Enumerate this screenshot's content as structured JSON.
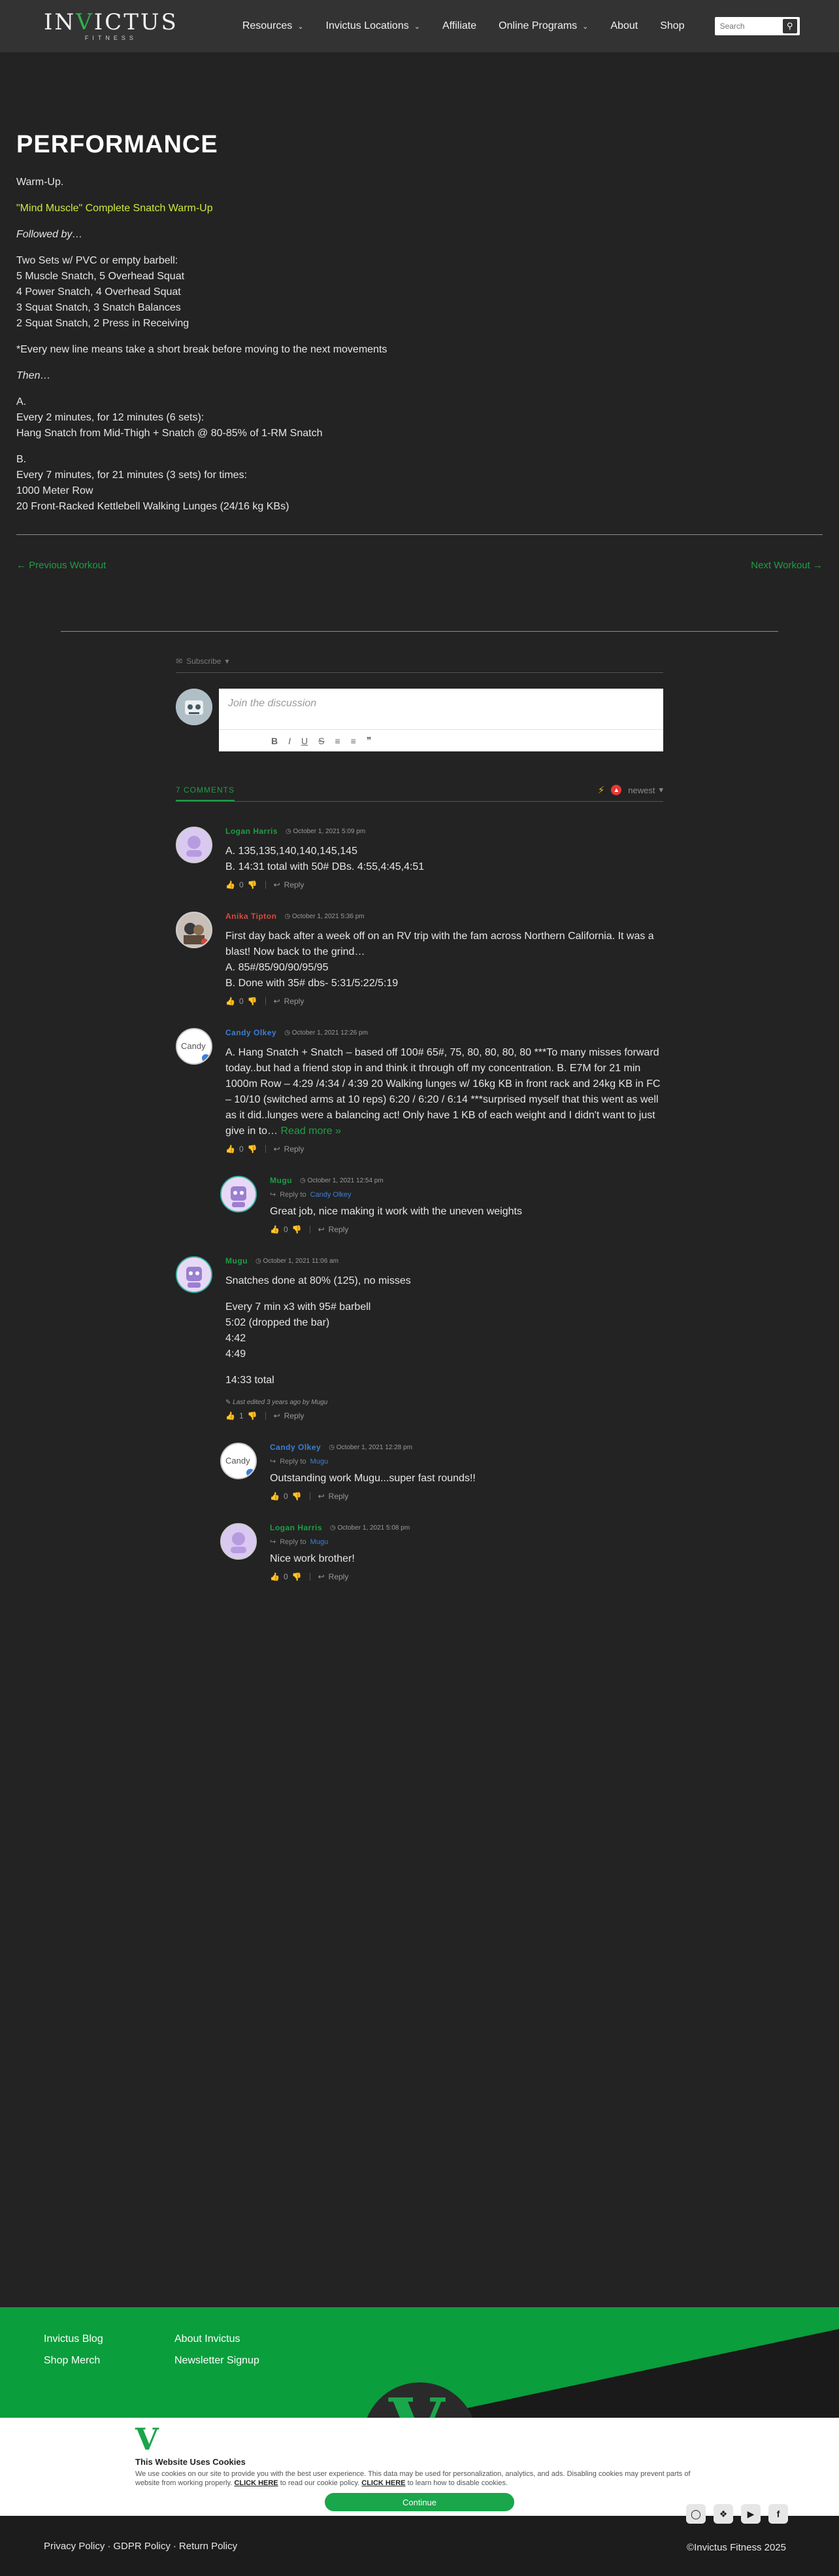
{
  "header": {
    "logo_word_a": "IN",
    "logo_word_v": "V",
    "logo_word_b": "ICTUS",
    "logo_sub": "FITNESS",
    "nav": [
      {
        "label": "Resources",
        "dropdown": true
      },
      {
        "label": "Invictus Locations",
        "dropdown": true
      },
      {
        "label": "Affiliate",
        "dropdown": false
      },
      {
        "label": "Online Programs",
        "dropdown": true
      },
      {
        "label": "About",
        "dropdown": false
      },
      {
        "label": "Shop",
        "dropdown": false
      }
    ],
    "search_placeholder": "Search"
  },
  "workout": {
    "title": "PERFORMANCE",
    "warmup": "Warm-Up.",
    "warmup_link": "\"Mind Muscle\" Complete Snatch Warm-Up",
    "followed_by": "Followed by…",
    "lines_sets": [
      "Two Sets w/ PVC or empty barbell:",
      "5 Muscle Snatch, 5 Overhead Squat",
      "4 Power Snatch, 4 Overhead Squat",
      "3 Squat Snatch, 3 Snatch Balances",
      "2 Squat Snatch, 2 Press in Receiving"
    ],
    "note": "*Every new line means take a short break before moving to the next movements",
    "then": "Then…",
    "part_a": [
      "A.",
      "Every 2 minutes, for 12 minutes (6 sets):",
      "Hang Snatch from Mid-Thigh + Snatch @ 80-85% of 1-RM Snatch"
    ],
    "part_b": [
      "B.",
      "Every 7 minutes, for 21 minutes (3 sets) for times:",
      "1000 Meter Row",
      "20 Front-Racked Kettlebell Walking Lunges (24/16 kg KBs)"
    ],
    "prev": "← Previous Workout",
    "next": "Next Workout →"
  },
  "comments_ui": {
    "subscribe": "Subscribe",
    "compose_placeholder": "Join the discussion",
    "toolbar": [
      "B",
      "I",
      "U",
      "S",
      "≡",
      "≡",
      "❞"
    ],
    "count": "7 COMMENTS",
    "sort": "newest"
  },
  "comments": [
    {
      "author": "Logan Harris",
      "color": "green",
      "date": "October 1, 2021 5:09 pm",
      "lines": [
        "A. 135,135,140,140,145,145",
        "B. 14:31 total with 50# DBs. 4:55,4:45,4:51"
      ],
      "likes": "0",
      "reply": "Reply"
    },
    {
      "author": "Anika Tipton",
      "color": "red",
      "date": "October 1, 2021 5:36 pm",
      "lines": [
        "First day back after a week off on an RV trip with the fam across Northern California. It was a blast! Now back to the grind…",
        "A. 85#/85/90/90/95/95",
        "B. Done with 35# dbs- 5:31/5:22/5:19"
      ],
      "likes": "0",
      "reply": "Reply"
    },
    {
      "author": "Candy Olkey",
      "color": "blue",
      "date": "October 1, 2021 12:26 pm",
      "lines": [
        "A. Hang Snatch + Snatch – based off 100# 65#, 75, 80, 80, 80, 80 ***To many misses forward today..but had a friend stop in and think it through off my concentration. B. E7M for 21 min 1000m Row – 4:29 /4:34 / 4:39 20 Walking lunges w/ 16kg KB in front rack and 24kg KB in FC – 10/10 (switched arms at 10 reps) 6:20 / 6:20 / 6:14 ***surprised myself that this went as well as it did..lunges were a balancing act! Only have 1 KB of each weight and I didn't want to just give in to…"
      ],
      "read_more": "Read more »",
      "likes": "0",
      "reply": "Reply"
    },
    {
      "author": "Mugu",
      "color": "green",
      "date": "October 1, 2021 12:54 pm",
      "reply_to": "Candy Olkey",
      "lines": [
        "Great job, nice making it work with the uneven weights"
      ],
      "likes": "0",
      "reply": "Reply"
    },
    {
      "author": "Mugu",
      "color": "green",
      "date": "October 1, 2021 11:06 am",
      "lines": [
        "Snatches done at 80% (125), no misses",
        "",
        "Every 7 min x3 with 95# barbell",
        "5:02 (dropped the bar)",
        "4:42",
        "4:49",
        "",
        "14:33 total"
      ],
      "edited": "Last edited 3 years ago by Mugu",
      "likes": "1",
      "reply": "Reply"
    },
    {
      "author": "Candy Olkey",
      "color": "blue",
      "date": "October 1, 2021 12:28 pm",
      "reply_to": "Mugu",
      "lines": [
        "Outstanding work Mugu...super fast rounds!!"
      ],
      "likes": "0",
      "reply": "Reply"
    },
    {
      "author": "Logan Harris",
      "color": "green",
      "date": "October 1, 2021 5:08 pm",
      "reply_to": "Mugu",
      "lines": [
        "Nice work brother!"
      ],
      "likes": "0",
      "reply": "Reply"
    }
  ],
  "footer": {
    "col1": [
      "Invictus Blog",
      "Shop Merch"
    ],
    "col2": [
      "About Invictus",
      "Newsletter Signup"
    ],
    "cookie_title": "This Website Uses Cookies",
    "cookie_text_1": "We use cookies on our site to provide you with the best user experience. This data may be used for personalization, analytics, and ads. Disabling cookies may prevent parts of website from working properly.",
    "cookie_link_1": "CLICK HERE",
    "cookie_text_2": "to read our cookie policy.",
    "cookie_link_2": "CLICK HERE",
    "cookie_text_3": "to learn how to disable cookies.",
    "continue": "Continue",
    "links": [
      "Privacy Policy",
      "GDPR Policy",
      "Return Policy"
    ],
    "copyright": "©Invictus Fitness 2025"
  },
  "colors": {
    "accent_green": "#1e9e46",
    "link_yellow": "#cde93b",
    "footer_green": "#0a9e3c"
  }
}
